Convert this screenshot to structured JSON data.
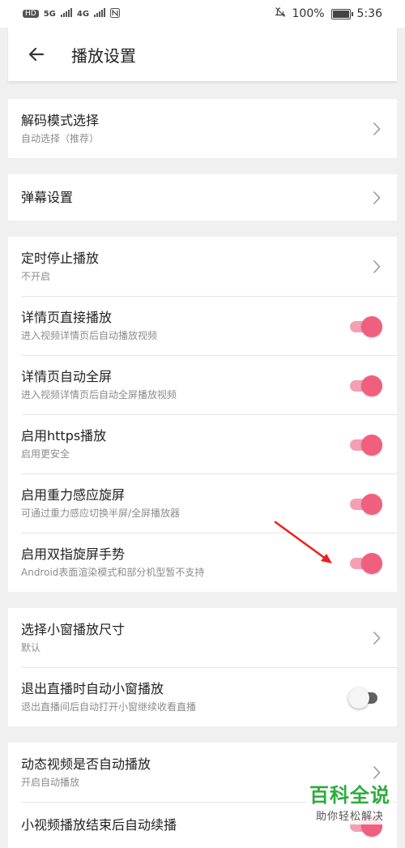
{
  "status_bar": {
    "network_left": "HD",
    "signal_1": "5G",
    "signal_2": "4G",
    "battery_percent": "100%",
    "time": "5:36"
  },
  "app_bar": {
    "title": "播放设置"
  },
  "sections": [
    {
      "rows": [
        {
          "title": "解码模式选择",
          "subtitle": "自动选择（推荐）",
          "control": "chevron"
        }
      ]
    },
    {
      "rows": [
        {
          "title": "弹幕设置",
          "control": "chevron"
        }
      ]
    },
    {
      "rows": [
        {
          "title": "定时停止播放",
          "subtitle": "不开启",
          "control": "chevron"
        },
        {
          "title": "详情页直接播放",
          "subtitle": "进入视频详情页后自动播放视频",
          "control": "toggle",
          "on": true
        },
        {
          "title": "详情页自动全屏",
          "subtitle": "进入视频详情页后自动全屏播放视频",
          "control": "toggle",
          "on": true
        },
        {
          "title": "启用https播放",
          "subtitle": "启用更安全",
          "control": "toggle",
          "on": true
        },
        {
          "title": "启用重力感应旋屏",
          "subtitle": "可通过重力感应切换半屏/全屏播放器",
          "control": "toggle",
          "on": true
        },
        {
          "title": "启用双指旋屏手势",
          "subtitle": "Android表面渲染模式和部分机型暂不支持",
          "control": "toggle",
          "on": true
        }
      ]
    },
    {
      "rows": [
        {
          "title": "选择小窗播放尺寸",
          "subtitle": "默认",
          "control": "chevron"
        },
        {
          "title": "退出直播时自动小窗播放",
          "subtitle": "退出直播间后自动打开小窗继续收看直播",
          "control": "toggle",
          "on": false
        }
      ]
    },
    {
      "rows": [
        {
          "title": "动态视频是否自动播放",
          "subtitle": "开启自动播放",
          "control": "chevron"
        },
        {
          "title": "小视频播放结束后自动续播",
          "control": "toggle",
          "on": true
        }
      ]
    }
  ],
  "colors": {
    "accent": "#f0607e",
    "accent_track": "#f4a0b4",
    "annotation_arrow": "#e8231f"
  },
  "watermark": {
    "logo": "百科全说",
    "tagline": "助你轻松解决"
  }
}
